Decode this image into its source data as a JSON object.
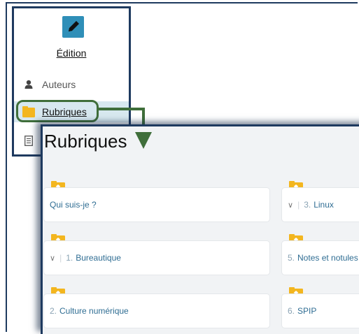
{
  "menu": {
    "title": "Édition",
    "items": [
      {
        "label": "Auteurs",
        "icon": "user-icon"
      },
      {
        "label": "Rubriques",
        "icon": "folder-icon"
      },
      {
        "label": "",
        "icon": "document-icon"
      }
    ]
  },
  "panel": {
    "title": "Rubriques",
    "cards": [
      {
        "label": "Qui suis-je ?",
        "number": "",
        "chevron": false
      },
      {
        "label": "Linux",
        "number": "3.",
        "chevron": true
      },
      {
        "label": "Bureautique",
        "number": "1.",
        "chevron": true
      },
      {
        "label": "Notes et notules",
        "number": "5.",
        "chevron": false
      },
      {
        "label": "Culture numérique",
        "number": "2.",
        "chevron": false
      },
      {
        "label": "SPIP",
        "number": "6.",
        "chevron": false
      }
    ]
  },
  "colors": {
    "accent": "#2f8fb8",
    "border": "#1e3a5f",
    "highlight": "#3f6e3a",
    "folder": "#f3b61f",
    "link": "#2f6d93"
  }
}
